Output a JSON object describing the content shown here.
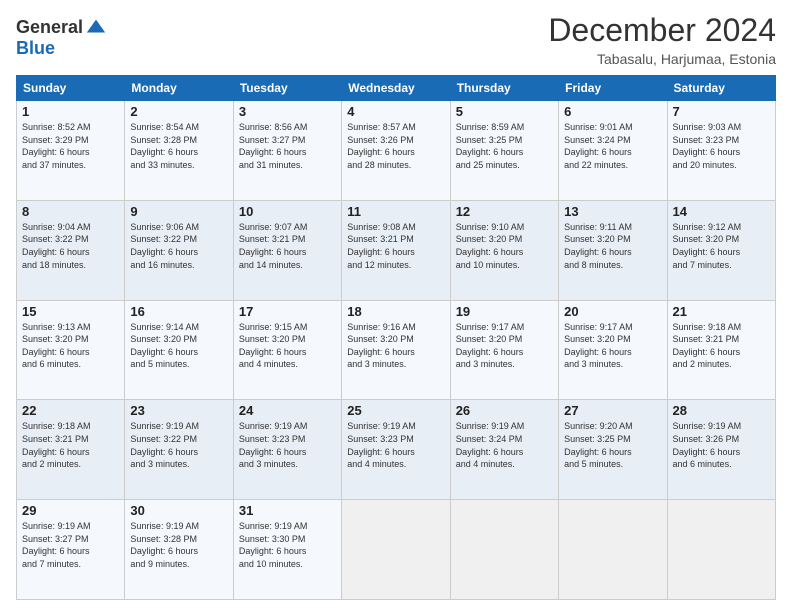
{
  "header": {
    "logo": {
      "general": "General",
      "blue": "Blue"
    },
    "title": "December 2024",
    "location": "Tabasalu, Harjumaa, Estonia"
  },
  "weekdays": [
    "Sunday",
    "Monday",
    "Tuesday",
    "Wednesday",
    "Thursday",
    "Friday",
    "Saturday"
  ],
  "weeks": [
    [
      {
        "day": "1",
        "sunrise": "8:52 AM",
        "sunset": "3:29 PM",
        "daylight_hours": "6",
        "daylight_minutes": "37"
      },
      {
        "day": "2",
        "sunrise": "8:54 AM",
        "sunset": "3:28 PM",
        "daylight_hours": "6",
        "daylight_minutes": "33"
      },
      {
        "day": "3",
        "sunrise": "8:56 AM",
        "sunset": "3:27 PM",
        "daylight_hours": "6",
        "daylight_minutes": "31"
      },
      {
        "day": "4",
        "sunrise": "8:57 AM",
        "sunset": "3:26 PM",
        "daylight_hours": "6",
        "daylight_minutes": "28"
      },
      {
        "day": "5",
        "sunrise": "8:59 AM",
        "sunset": "3:25 PM",
        "daylight_hours": "6",
        "daylight_minutes": "25"
      },
      {
        "day": "6",
        "sunrise": "9:01 AM",
        "sunset": "3:24 PM",
        "daylight_hours": "6",
        "daylight_minutes": "22"
      },
      {
        "day": "7",
        "sunrise": "9:03 AM",
        "sunset": "3:23 PM",
        "daylight_hours": "6",
        "daylight_minutes": "20"
      }
    ],
    [
      {
        "day": "8",
        "sunrise": "9:04 AM",
        "sunset": "3:22 PM",
        "daylight_hours": "6",
        "daylight_minutes": "18"
      },
      {
        "day": "9",
        "sunrise": "9:06 AM",
        "sunset": "3:22 PM",
        "daylight_hours": "6",
        "daylight_minutes": "16"
      },
      {
        "day": "10",
        "sunrise": "9:07 AM",
        "sunset": "3:21 PM",
        "daylight_hours": "6",
        "daylight_minutes": "14"
      },
      {
        "day": "11",
        "sunrise": "9:08 AM",
        "sunset": "3:21 PM",
        "daylight_hours": "6",
        "daylight_minutes": "12"
      },
      {
        "day": "12",
        "sunrise": "9:10 AM",
        "sunset": "3:20 PM",
        "daylight_hours": "6",
        "daylight_minutes": "10"
      },
      {
        "day": "13",
        "sunrise": "9:11 AM",
        "sunset": "3:20 PM",
        "daylight_hours": "6",
        "daylight_minutes": "8"
      },
      {
        "day": "14",
        "sunrise": "9:12 AM",
        "sunset": "3:20 PM",
        "daylight_hours": "6",
        "daylight_minutes": "7"
      }
    ],
    [
      {
        "day": "15",
        "sunrise": "9:13 AM",
        "sunset": "3:20 PM",
        "daylight_hours": "6",
        "daylight_minutes": "6"
      },
      {
        "day": "16",
        "sunrise": "9:14 AM",
        "sunset": "3:20 PM",
        "daylight_hours": "6",
        "daylight_minutes": "5"
      },
      {
        "day": "17",
        "sunrise": "9:15 AM",
        "sunset": "3:20 PM",
        "daylight_hours": "6",
        "daylight_minutes": "4"
      },
      {
        "day": "18",
        "sunrise": "9:16 AM",
        "sunset": "3:20 PM",
        "daylight_hours": "6",
        "daylight_minutes": "3"
      },
      {
        "day": "19",
        "sunrise": "9:17 AM",
        "sunset": "3:20 PM",
        "daylight_hours": "6",
        "daylight_minutes": "3"
      },
      {
        "day": "20",
        "sunrise": "9:17 AM",
        "sunset": "3:20 PM",
        "daylight_hours": "6",
        "daylight_minutes": "3"
      },
      {
        "day": "21",
        "sunrise": "9:18 AM",
        "sunset": "3:21 PM",
        "daylight_hours": "6",
        "daylight_minutes": "2"
      }
    ],
    [
      {
        "day": "22",
        "sunrise": "9:18 AM",
        "sunset": "3:21 PM",
        "daylight_hours": "6",
        "daylight_minutes": "2"
      },
      {
        "day": "23",
        "sunrise": "9:19 AM",
        "sunset": "3:22 PM",
        "daylight_hours": "6",
        "daylight_minutes": "3"
      },
      {
        "day": "24",
        "sunrise": "9:19 AM",
        "sunset": "3:23 PM",
        "daylight_hours": "6",
        "daylight_minutes": "3"
      },
      {
        "day": "25",
        "sunrise": "9:19 AM",
        "sunset": "3:23 PM",
        "daylight_hours": "6",
        "daylight_minutes": "4"
      },
      {
        "day": "26",
        "sunrise": "9:19 AM",
        "sunset": "3:24 PM",
        "daylight_hours": "6",
        "daylight_minutes": "4"
      },
      {
        "day": "27",
        "sunrise": "9:20 AM",
        "sunset": "3:25 PM",
        "daylight_hours": "6",
        "daylight_minutes": "5"
      },
      {
        "day": "28",
        "sunrise": "9:19 AM",
        "sunset": "3:26 PM",
        "daylight_hours": "6",
        "daylight_minutes": "6"
      }
    ],
    [
      {
        "day": "29",
        "sunrise": "9:19 AM",
        "sunset": "3:27 PM",
        "daylight_hours": "6",
        "daylight_minutes": "7"
      },
      {
        "day": "30",
        "sunrise": "9:19 AM",
        "sunset": "3:28 PM",
        "daylight_hours": "6",
        "daylight_minutes": "9"
      },
      {
        "day": "31",
        "sunrise": "9:19 AM",
        "sunset": "3:30 PM",
        "daylight_hours": "6",
        "daylight_minutes": "10"
      },
      null,
      null,
      null,
      null
    ]
  ]
}
